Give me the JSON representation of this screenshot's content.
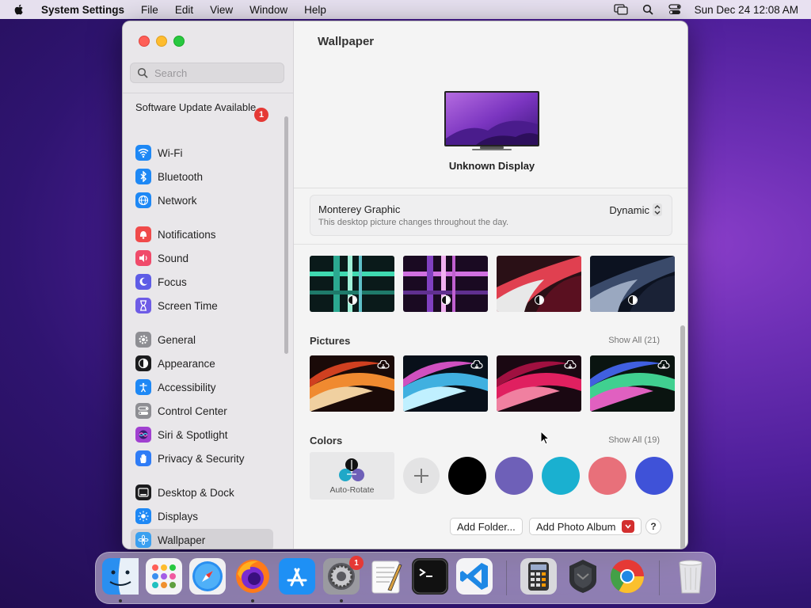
{
  "menubar": {
    "app_name": "System Settings",
    "menus": [
      "File",
      "Edit",
      "View",
      "Window",
      "Help"
    ],
    "clock": "Sun Dec 24  12:08 AM"
  },
  "sidebar": {
    "search_placeholder": "Search",
    "update": {
      "label": "Software Update Available",
      "badge": "1"
    },
    "groups": [
      [
        {
          "label": "Wi-Fi",
          "icon": "wifi-icon",
          "color": "#1e88f5"
        },
        {
          "label": "Bluetooth",
          "icon": "bluetooth-icon",
          "color": "#1e88f5"
        },
        {
          "label": "Network",
          "icon": "globe-icon",
          "color": "#1e88f5"
        }
      ],
      [
        {
          "label": "Notifications",
          "icon": "bell-icon",
          "color": "#f04a4a"
        },
        {
          "label": "Sound",
          "icon": "speaker-icon",
          "color": "#f04a6a"
        },
        {
          "label": "Focus",
          "icon": "moon-icon",
          "color": "#5e5ce6"
        },
        {
          "label": "Screen Time",
          "icon": "hourglass-icon",
          "color": "#6e5ce6"
        }
      ],
      [
        {
          "label": "General",
          "icon": "gear-icon",
          "color": "#8e8e93"
        },
        {
          "label": "Appearance",
          "icon": "appearance-icon",
          "color": "#1c1c1e"
        },
        {
          "label": "Accessibility",
          "icon": "accessibility-icon",
          "color": "#1e88f5"
        },
        {
          "label": "Control Center",
          "icon": "toggles-icon",
          "color": "#8e8e93"
        },
        {
          "label": "Siri & Spotlight",
          "icon": "siri-icon",
          "color": "#a040d0"
        },
        {
          "label": "Privacy & Security",
          "icon": "hand-icon",
          "color": "#2f7cf6"
        }
      ],
      [
        {
          "label": "Desktop & Dock",
          "icon": "dock-icon",
          "color": "#1c1c1e"
        },
        {
          "label": "Displays",
          "icon": "sun-icon",
          "color": "#1e88f5"
        },
        {
          "label": "Wallpaper",
          "icon": "flower-icon",
          "color": "#3aa0f0",
          "active": true
        }
      ]
    ]
  },
  "main": {
    "title": "Wallpaper",
    "display_name": "Unknown Display",
    "current_wallpaper": {
      "name": "Monterey Graphic",
      "description": "This desktop picture changes throughout the day.",
      "mode": "Dynamic"
    },
    "pictures": {
      "title": "Pictures",
      "show_all": "Show All (21)"
    },
    "colors": {
      "title": "Colors",
      "show_all": "Show All (19)",
      "auto_rotate_label": "Auto-Rotate",
      "swatches": [
        "#000000",
        "#6e60b8",
        "#1ab0d0",
        "#e8707a",
        "#3f52d8"
      ]
    },
    "buttons": {
      "add_folder": "Add Folder...",
      "add_photo_album": "Add Photo Album",
      "help": "?"
    }
  },
  "dock": {
    "settings_badge": "1"
  }
}
